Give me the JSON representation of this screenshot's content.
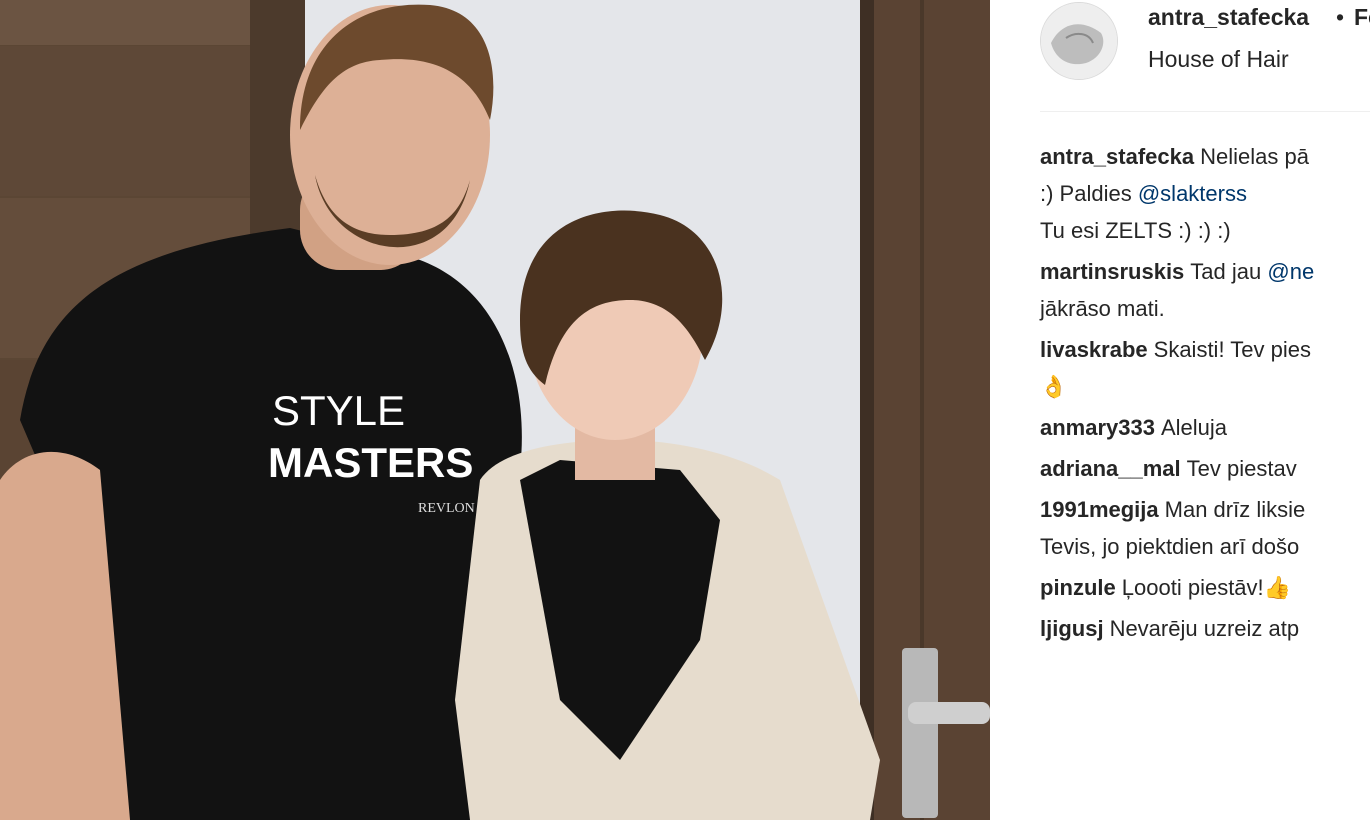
{
  "post": {
    "author": "antra_stafecka",
    "separator": "•",
    "follow_label": "Follow",
    "location": "House of Hair",
    "shirt_line1": "STYLE",
    "shirt_line2": "MASTERS",
    "shirt_brand": "REVLON"
  },
  "comments": [
    {
      "user": "antra_stafecka",
      "lines": [
        "Nelielas pā",
        ":) Paldies",
        "Tu esi ZELTS :) :) :)"
      ],
      "mention": "@slakterss"
    },
    {
      "user": "martinsruskis",
      "lines": [
        "Tad jau",
        "jākrāso mati."
      ],
      "mention": "@ne"
    },
    {
      "user": "livaskrabe",
      "lines": [
        "Skaisti! Tev pies",
        "👌"
      ]
    },
    {
      "user": "anmary333",
      "lines": [
        "Aleluja"
      ]
    },
    {
      "user": "adriana__mal",
      "lines": [
        "Tev piestav"
      ]
    },
    {
      "user": "1991megija",
      "lines": [
        "Man drīz liksie",
        "Tevis, jo piektdien arī došo"
      ]
    },
    {
      "user": "pinzule",
      "lines": [
        "Ļoooti piestāv!👍"
      ]
    },
    {
      "user": "ljigusj",
      "lines": [
        "Nevarēju uzreiz atp"
      ]
    }
  ]
}
